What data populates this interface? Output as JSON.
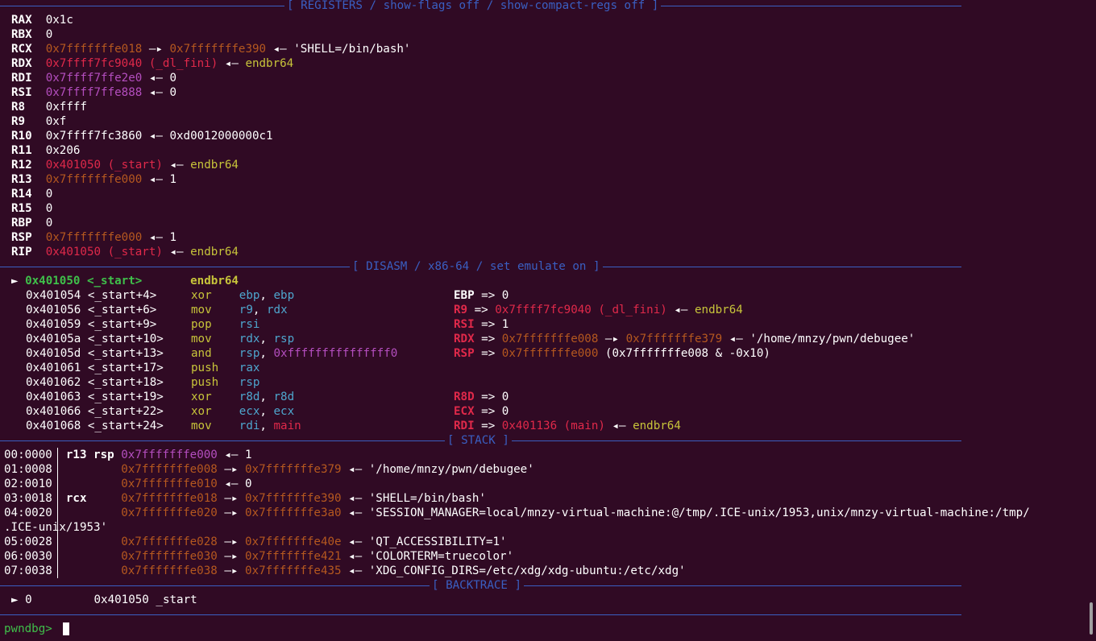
{
  "headers": {
    "registers": "[ REGISTERS / show-flags off / show-compact-regs off ]",
    "disasm": "[ DISASM / x86-64 / set emulate on ]",
    "stack": "[ STACK ]",
    "backtrace": "[ BACKTRACE ]"
  },
  "registers": [
    {
      "name": "RAX",
      "value": "0x1c",
      "chain": ""
    },
    {
      "name": "RBX",
      "value": "0",
      "chain": ""
    },
    {
      "name": "RCX",
      "value": "0x7fffffffe018",
      "chain": "—▸ 0x7fffffffe390 ◂— 'SHELL=/bin/bash'"
    },
    {
      "name": "RDX",
      "value": "0x7ffff7fc9040 (_dl_fini)",
      "chain": "◂— endbr64"
    },
    {
      "name": "RDI",
      "value": "0x7ffff7ffe2e0",
      "chain": "◂— 0"
    },
    {
      "name": "RSI",
      "value": "0x7ffff7ffe888",
      "chain": "◂— 0"
    },
    {
      "name": "R8",
      "value": "0xffff",
      "chain": ""
    },
    {
      "name": "R9",
      "value": "0xf",
      "chain": ""
    },
    {
      "name": "R10",
      "value": "0x7ffff7fc3860",
      "chain": "◂— 0xd0012000000c1"
    },
    {
      "name": "R11",
      "value": "0x206",
      "chain": ""
    },
    {
      "name": "R12",
      "value": "0x401050 (_start)",
      "chain": "◂— endbr64"
    },
    {
      "name": "R13",
      "value": "0x7fffffffe000",
      "chain": "◂— 1"
    },
    {
      "name": "R14",
      "value": "0",
      "chain": ""
    },
    {
      "name": "R15",
      "value": "0",
      "chain": ""
    },
    {
      "name": "RBP",
      "value": "0",
      "chain": ""
    },
    {
      "name": "RSP",
      "value": "0x7fffffffe000",
      "chain": "◂— 1"
    },
    {
      "name": "RIP",
      "value": "0x401050 (_start)",
      "chain": "◂— endbr64"
    }
  ],
  "disasm": [
    {
      "marker": "►",
      "addr": "0x401050",
      "sym": "<_start>",
      "mn": "endbr64",
      "ops": "",
      "note": ""
    },
    {
      "marker": "",
      "addr": "0x401054",
      "sym": "<_start+4>",
      "mn": "xor",
      "ops": "ebp, ebp",
      "note": "EBP => 0"
    },
    {
      "marker": "",
      "addr": "0x401056",
      "sym": "<_start+6>",
      "mn": "mov",
      "ops": "r9, rdx",
      "note": "R9 => 0x7ffff7fc9040 (_dl_fini) ◂— endbr64"
    },
    {
      "marker": "",
      "addr": "0x401059",
      "sym": "<_start+9>",
      "mn": "pop",
      "ops": "rsi",
      "note": "RSI => 1"
    },
    {
      "marker": "",
      "addr": "0x40105a",
      "sym": "<_start+10>",
      "mn": "mov",
      "ops": "rdx, rsp",
      "note": "RDX => 0x7fffffffe008 —▸ 0x7fffffffe379 ◂— '/home/mnzy/pwn/debugee'"
    },
    {
      "marker": "",
      "addr": "0x40105d",
      "sym": "<_start+13>",
      "mn": "and",
      "ops": "rsp, 0xfffffffffffffff0",
      "note": "RSP => 0x7fffffffe000 (0x7fffffffe008 & -0x10)"
    },
    {
      "marker": "",
      "addr": "0x401061",
      "sym": "<_start+17>",
      "mn": "push",
      "ops": "rax",
      "note": ""
    },
    {
      "marker": "",
      "addr": "0x401062",
      "sym": "<_start+18>",
      "mn": "push",
      "ops": "rsp",
      "note": ""
    },
    {
      "marker": "",
      "addr": "0x401063",
      "sym": "<_start+19>",
      "mn": "xor",
      "ops": "r8d, r8d",
      "note": "R8D => 0"
    },
    {
      "marker": "",
      "addr": "0x401066",
      "sym": "<_start+22>",
      "mn": "xor",
      "ops": "ecx, ecx",
      "note": "ECX => 0"
    },
    {
      "marker": "",
      "addr": "0x401068",
      "sym": "<_start+24>",
      "mn": "mov",
      "ops": "rdi, main",
      "note": "RDI => 0x401136 (main) ◂— endbr64"
    }
  ],
  "stack": [
    {
      "off": "00:0000",
      "regs": "r13 rsp",
      "addr": "0x7fffffffe000",
      "chain": "◂— 1"
    },
    {
      "off": "01:0008",
      "regs": "",
      "addr": "0x7fffffffe008",
      "chain": "—▸ 0x7fffffffe379 ◂— '/home/mnzy/pwn/debugee'"
    },
    {
      "off": "02:0010",
      "regs": "",
      "addr": "0x7fffffffe010",
      "chain": "◂— 0"
    },
    {
      "off": "03:0018",
      "regs": "rcx",
      "addr": "0x7fffffffe018",
      "chain": "—▸ 0x7fffffffe390 ◂— 'SHELL=/bin/bash'"
    },
    {
      "off": "04:0020",
      "regs": "",
      "addr": "0x7fffffffe020",
      "chain": "—▸ 0x7fffffffe3a0 ◂— 'SESSION_MANAGER=local/mnzy-virtual-machine:@/tmp/.ICE-unix/1953,unix/mnzy-virtual-machine:/tmp/",
      "wrap": ".ICE-unix/1953'"
    },
    {
      "off": "05:0028",
      "regs": "",
      "addr": "0x7fffffffe028",
      "chain": "—▸ 0x7fffffffe40e ◂— 'QT_ACCESSIBILITY=1'"
    },
    {
      "off": "06:0030",
      "regs": "",
      "addr": "0x7fffffffe030",
      "chain": "—▸ 0x7fffffffe421 ◂— 'COLORTERM=truecolor'"
    },
    {
      "off": "07:0038",
      "regs": "",
      "addr": "0x7fffffffe038",
      "chain": "—▸ 0x7fffffffe435 ◂— 'XDG_CONFIG_DIRS=/etc/xdg/xdg-ubuntu:/etc/xdg'"
    }
  ],
  "backtrace": {
    "marker": "►",
    "index": "0",
    "addr": "0x401050",
    "sym": "_start"
  },
  "prompt": "pwndbg>",
  "colors": {
    "background": "#300a24",
    "header": "#3a5fc2",
    "address": "#b5581f",
    "symbol": "#e0294a",
    "stack_ptr": "#b44ebf",
    "instruction": "#c7c43a",
    "current": "#3fbf4a",
    "register_op": "#4ea6ce"
  }
}
